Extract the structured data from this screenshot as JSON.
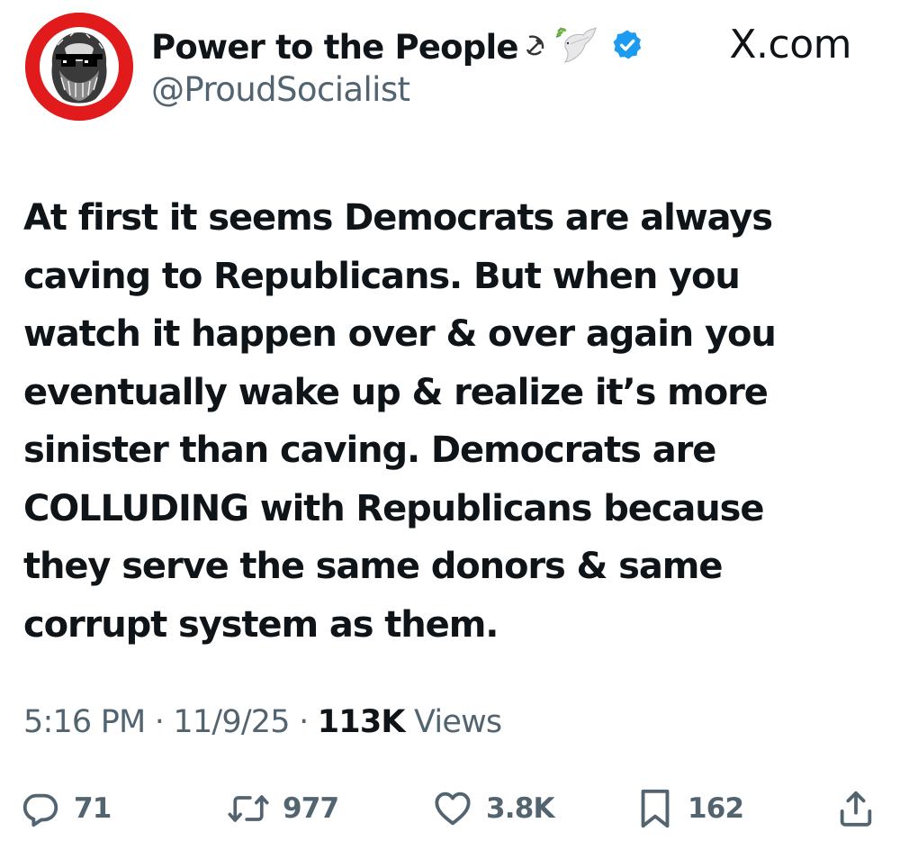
{
  "header": {
    "display_name": "Power to the People",
    "name_emojis": [
      "hammer-and-sickle-icon",
      "dove-icon"
    ],
    "handle": "@ProudSocialist",
    "source_label": "X.com",
    "verified": true,
    "verified_color": "#1d9bf0"
  },
  "tweet": {
    "lines": [
      "At first it seems Democrats are always",
      "caving to Republicans. But when you",
      "watch it happen over & over again you",
      "eventually wake up & realize it’s more",
      "sinister than caving. Democrats are",
      "COLLUDING with Republicans because",
      "they serve the same donors & same",
      "corrupt system as them."
    ]
  },
  "meta": {
    "time": "5:16 PM",
    "separator": "·",
    "date": "11/9/25",
    "views_count": "113K",
    "views_label": "Views"
  },
  "actions": {
    "replies": "71",
    "retweets": "977",
    "likes": "3.8K",
    "bookmarks": "162"
  },
  "colors": {
    "text": "#0f1419",
    "secondary": "#536471",
    "avatar_ring": "#e11b1b"
  }
}
